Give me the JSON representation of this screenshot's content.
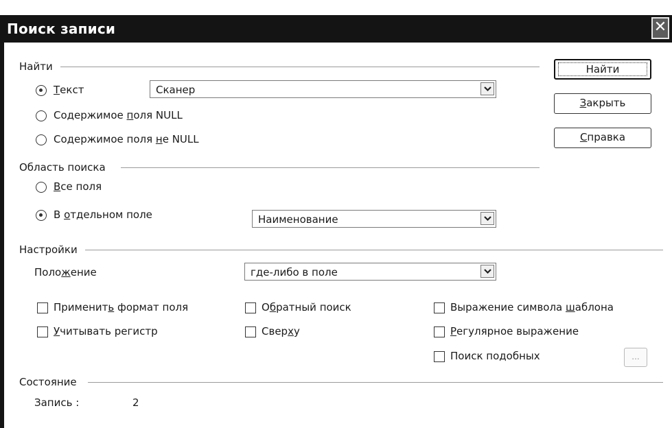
{
  "window": {
    "title": "Поиск записи",
    "close_symbol": "✕"
  },
  "find_group": {
    "label": "Найти",
    "options": [
      {
        "pre": "",
        "u": "Т",
        "post": "екст",
        "selected": true
      },
      {
        "pre": "Содержимое ",
        "u": "п",
        "post": "оля NULL",
        "selected": false
      },
      {
        "pre": "Содержимое поля ",
        "u": "н",
        "post": "е NULL",
        "selected": false
      }
    ],
    "text_value": "Сканер"
  },
  "buttons": {
    "find": "Найти",
    "close": {
      "pre": "",
      "u": "З",
      "post": "акрыть"
    },
    "help": {
      "pre": "",
      "u": "С",
      "post": "правка"
    }
  },
  "scope_group": {
    "label": "Область поиска",
    "all_fields": {
      "pre": "",
      "u": "В",
      "post": "се поля",
      "selected": false
    },
    "single_field": {
      "pre": "В ",
      "u": "о",
      "post": "тдельном поле",
      "selected": true
    },
    "field_value": "Наименование"
  },
  "settings_group": {
    "label": "Настройки",
    "position_label": {
      "pre": "Поло",
      "u": "ж",
      "post": "ение"
    },
    "position_value": "где-либо в поле",
    "checkboxes": {
      "apply_format": {
        "pre": "Применит",
        "u": "ь",
        "post": " формат поля",
        "checked": false
      },
      "match_case": {
        "pre": "",
        "u": "У",
        "post": "читывать регистр",
        "checked": false
      },
      "backwards": {
        "pre": "О",
        "u": "б",
        "post": "ратный поиск",
        "checked": false
      },
      "from_top": {
        "pre": "Свер",
        "u": "х",
        "post": "у",
        "checked": false
      },
      "wildcards": {
        "pre": "Выражение символа ",
        "u": "ш",
        "post": "аблона",
        "checked": false
      },
      "regex": {
        "pre": "",
        "u": "Р",
        "post": "егулярное выражение",
        "checked": false
      },
      "similarity": {
        "pre": "Поиск по",
        "u": "д",
        "post": "обных",
        "checked": false
      }
    },
    "similarity_button": "..."
  },
  "status_group": {
    "label": "Состояние",
    "record_label": "Запись :",
    "record_value": "2"
  }
}
